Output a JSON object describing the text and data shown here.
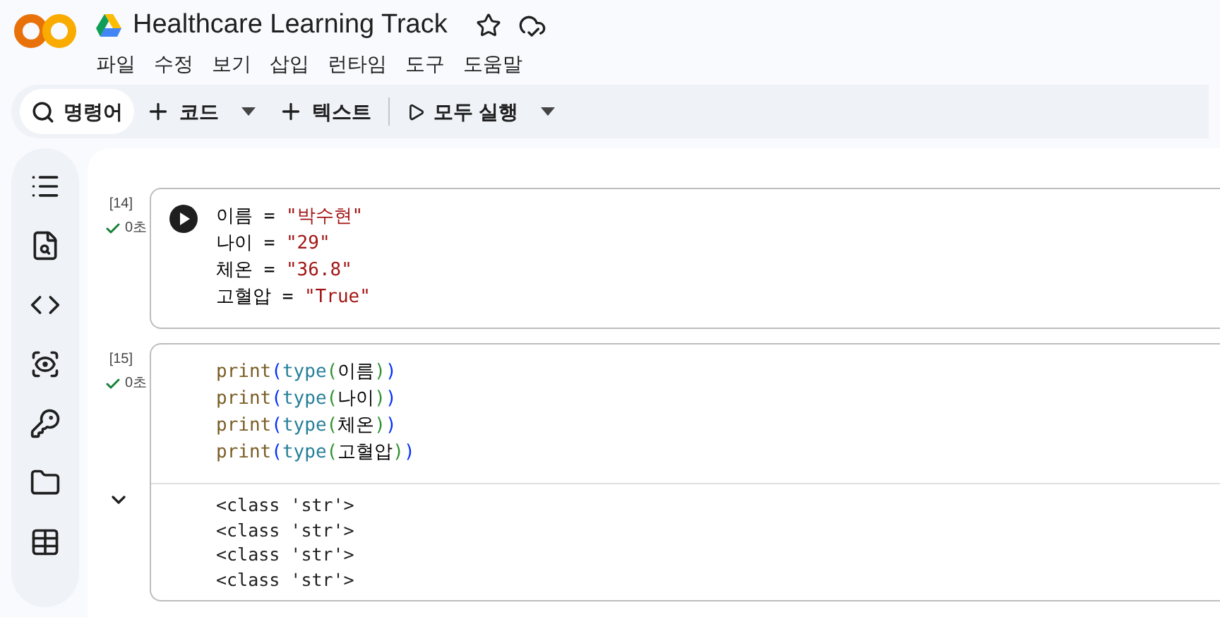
{
  "title": "Healthcare Learning Track",
  "menu": [
    "파일",
    "수정",
    "보기",
    "삽입",
    "런타임",
    "도구",
    "도움말"
  ],
  "toolbar": [
    {
      "kind": "search",
      "label": "명령어"
    },
    {
      "kind": "add",
      "label": "코드",
      "dropdown": true
    },
    {
      "kind": "add",
      "label": "텍스트",
      "dropdown": false
    },
    {
      "kind": "run",
      "label": "모두 실행",
      "dropdown": true
    }
  ],
  "cells": [
    {
      "count": "[14]",
      "time": "0초",
      "running_control": true,
      "lines": [
        [
          {
            "kind": "name",
            "text": "이름"
          },
          {
            "kind": "op",
            "text": " = "
          },
          {
            "kind": "string",
            "text": "\"박수현\""
          }
        ],
        [
          {
            "kind": "name",
            "text": "나이"
          },
          {
            "kind": "op",
            "text": " = "
          },
          {
            "kind": "string",
            "text": "\"29\""
          }
        ],
        [
          {
            "kind": "name",
            "text": "체온"
          },
          {
            "kind": "op",
            "text": " = "
          },
          {
            "kind": "string",
            "text": "\"36.8\""
          }
        ],
        [
          {
            "kind": "name",
            "text": "고혈압"
          },
          {
            "kind": "op",
            "text": " = "
          },
          {
            "kind": "string",
            "text": "\"True\""
          }
        ]
      ]
    },
    {
      "count": "[15]",
      "time": "0초",
      "running_control": false,
      "lines": [
        [
          {
            "kind": "builtin",
            "text": "print"
          },
          {
            "kind": "bracket1",
            "text": "("
          },
          {
            "kind": "type",
            "text": "type"
          },
          {
            "kind": "bracket2",
            "text": "("
          },
          {
            "kind": "name",
            "text": "이름"
          },
          {
            "kind": "bracket2",
            "text": ")"
          },
          {
            "kind": "bracket1",
            "text": ")"
          }
        ],
        [
          {
            "kind": "builtin",
            "text": "print"
          },
          {
            "kind": "bracket1",
            "text": "("
          },
          {
            "kind": "type",
            "text": "type"
          },
          {
            "kind": "bracket2",
            "text": "("
          },
          {
            "kind": "name",
            "text": "나이"
          },
          {
            "kind": "bracket2",
            "text": ")"
          },
          {
            "kind": "bracket1",
            "text": ")"
          }
        ],
        [
          {
            "kind": "builtin",
            "text": "print"
          },
          {
            "kind": "bracket1",
            "text": "("
          },
          {
            "kind": "type",
            "text": "type"
          },
          {
            "kind": "bracket2",
            "text": "("
          },
          {
            "kind": "name",
            "text": "체온"
          },
          {
            "kind": "bracket2",
            "text": ")"
          },
          {
            "kind": "bracket1",
            "text": ")"
          }
        ],
        [
          {
            "kind": "builtin",
            "text": "print"
          },
          {
            "kind": "bracket1",
            "text": "("
          },
          {
            "kind": "type",
            "text": "type"
          },
          {
            "kind": "bracket2",
            "text": "("
          },
          {
            "kind": "name",
            "text": "고혈압"
          },
          {
            "kind": "bracket2",
            "text": ")"
          },
          {
            "kind": "bracket1",
            "text": ")"
          }
        ]
      ],
      "output": [
        "<class 'str'>",
        "<class 'str'>",
        "<class 'str'>",
        "<class 'str'>"
      ]
    }
  ]
}
